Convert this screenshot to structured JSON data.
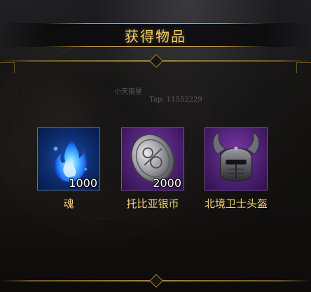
{
  "dialog": {
    "title": "获得物品"
  },
  "watermark": {
    "name": "小天狼星",
    "id": "Tap: 11552229"
  },
  "items": [
    {
      "name": "魂",
      "quantity": "1000",
      "rarity_color": "#1a4fb0",
      "icon": "blue-soul-flame-icon"
    },
    {
      "name": "托比亚银币",
      "quantity": "2000",
      "rarity_color": "#7a38a8",
      "icon": "silver-coin-icon"
    },
    {
      "name": "北境卫士头盔",
      "quantity": "",
      "rarity_color": "#7a38a8",
      "icon": "horned-helmet-icon"
    }
  ],
  "colors": {
    "title": "#f2cf6e",
    "item_name": "#f0d178",
    "border_gold": "#a8843c"
  }
}
